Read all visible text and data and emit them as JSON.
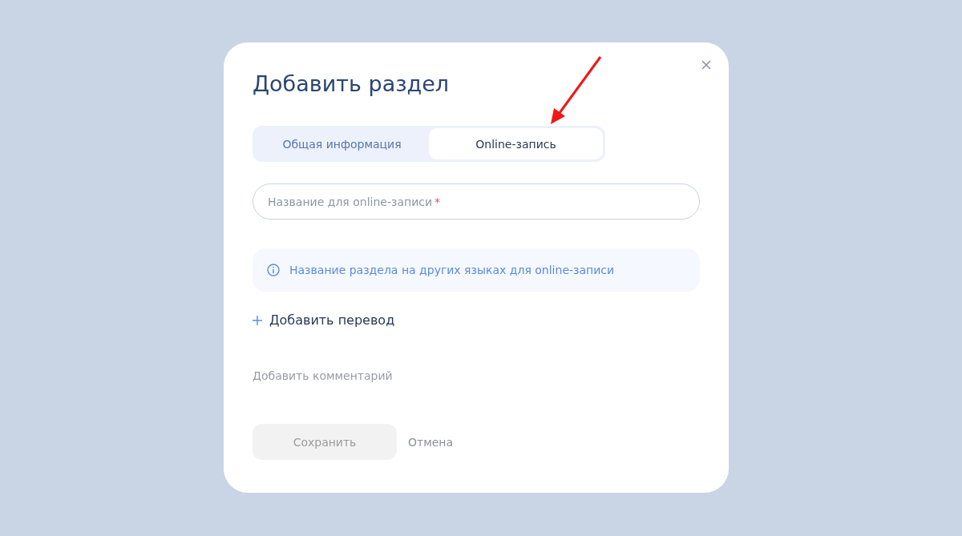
{
  "dialog": {
    "title": "Добавить раздел",
    "tabs": [
      {
        "label": "Общая информация",
        "selected": false
      },
      {
        "label": "Online-запись",
        "selected": true
      }
    ],
    "name_field": {
      "placeholder": "Название для online-записи",
      "required_mark": "*"
    },
    "info": {
      "text": "Название раздела на других языках для online-записи"
    },
    "add_translation": {
      "label": "Добавить перевод"
    },
    "add_comment": {
      "label": "Добавить комментарий"
    },
    "buttons": [
      {
        "kind": "primary",
        "label": "Сохранить",
        "disabled": true
      },
      {
        "kind": "link",
        "label": "Отмена",
        "disabled": false
      }
    ]
  }
}
